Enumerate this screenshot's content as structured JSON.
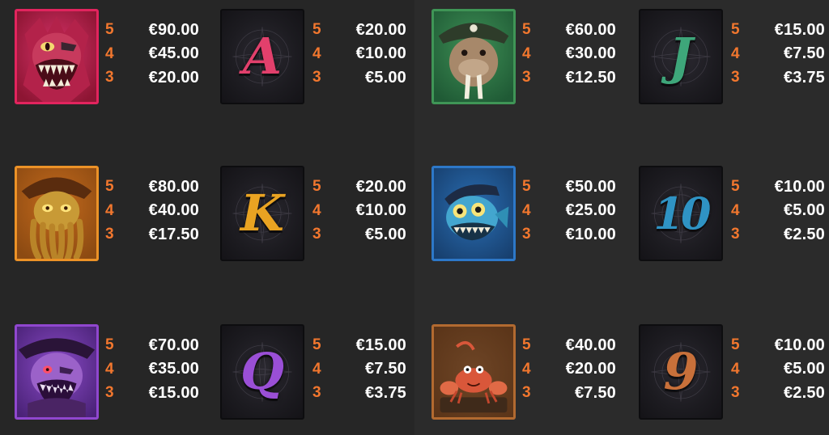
{
  "paytable": {
    "columns": [
      {
        "symbols": [
          {
            "name": "Red Sea Monster",
            "icon": "red-monster-icon",
            "frame_color": "#e2245e",
            "bg": "#8d1533",
            "pays": [
              {
                "count": "5",
                "value": "€90.00"
              },
              {
                "count": "4",
                "value": "€45.00"
              },
              {
                "count": "3",
                "value": "€20.00"
              }
            ]
          },
          {
            "name": "Octopus Captain",
            "icon": "octopus-captain-icon",
            "frame_color": "#ec9227",
            "bg": "#8c4a12",
            "pays": [
              {
                "count": "5",
                "value": "€80.00"
              },
              {
                "count": "4",
                "value": "€40.00"
              },
              {
                "count": "3",
                "value": "€17.50"
              }
            ]
          },
          {
            "name": "Purple Zombie Pirate",
            "icon": "purple-pirate-icon",
            "frame_color": "#9047cf",
            "bg": "#4a2277",
            "pays": [
              {
                "count": "5",
                "value": "€70.00"
              },
              {
                "count": "4",
                "value": "€35.00"
              },
              {
                "count": "3",
                "value": "€15.00"
              }
            ]
          }
        ]
      },
      {
        "symbols": [
          {
            "letter": "A",
            "icon": "letter-a-icon",
            "color": "#e2406c",
            "pays": [
              {
                "count": "5",
                "value": "€20.00"
              },
              {
                "count": "4",
                "value": "€10.00"
              },
              {
                "count": "3",
                "value": "€5.00"
              }
            ]
          },
          {
            "letter": "K",
            "icon": "letter-k-icon",
            "color": "#e9a322",
            "pays": [
              {
                "count": "5",
                "value": "€20.00"
              },
              {
                "count": "4",
                "value": "€10.00"
              },
              {
                "count": "3",
                "value": "€5.00"
              }
            ]
          },
          {
            "letter": "Q",
            "icon": "letter-q-icon",
            "color": "#9a4fd6",
            "pays": [
              {
                "count": "5",
                "value": "€15.00"
              },
              {
                "count": "4",
                "value": "€7.50"
              },
              {
                "count": "3",
                "value": "€3.75"
              }
            ]
          }
        ]
      },
      {
        "symbols": [
          {
            "name": "Walrus Captain",
            "icon": "walrus-captain-icon",
            "frame_color": "#3f9556",
            "bg": "#1f5a35",
            "pays": [
              {
                "count": "5",
                "value": "€60.00"
              },
              {
                "count": "4",
                "value": "€30.00"
              },
              {
                "count": "3",
                "value": "€12.50"
              }
            ]
          },
          {
            "name": "Blue Fish Pirate",
            "icon": "fish-pirate-icon",
            "frame_color": "#2d78c8",
            "bg": "#173f6e",
            "pays": [
              {
                "count": "5",
                "value": "€50.00"
              },
              {
                "count": "4",
                "value": "€25.00"
              },
              {
                "count": "3",
                "value": "€10.00"
              }
            ]
          },
          {
            "name": "Crab",
            "icon": "crab-icon",
            "frame_color": "#b26a30",
            "bg": "#5a3418",
            "pays": [
              {
                "count": "5",
                "value": "€40.00"
              },
              {
                "count": "4",
                "value": "€20.00"
              },
              {
                "count": "3",
                "value": "€7.50"
              }
            ]
          }
        ]
      },
      {
        "symbols": [
          {
            "letter": "J",
            "icon": "letter-j-icon",
            "color": "#3ea67a",
            "pays": [
              {
                "count": "5",
                "value": "€15.00"
              },
              {
                "count": "4",
                "value": "€7.50"
              },
              {
                "count": "3",
                "value": "€3.75"
              }
            ]
          },
          {
            "letter": "10",
            "icon": "number-10-icon",
            "color": "#2f93c4",
            "pays": [
              {
                "count": "5",
                "value": "€10.00"
              },
              {
                "count": "4",
                "value": "€5.00"
              },
              {
                "count": "3",
                "value": "€2.50"
              }
            ]
          },
          {
            "letter": "9",
            "icon": "number-9-icon",
            "color": "#c8703a",
            "pays": [
              {
                "count": "5",
                "value": "€10.00"
              },
              {
                "count": "4",
                "value": "€5.00"
              },
              {
                "count": "3",
                "value": "€2.50"
              }
            ]
          }
        ]
      }
    ]
  }
}
